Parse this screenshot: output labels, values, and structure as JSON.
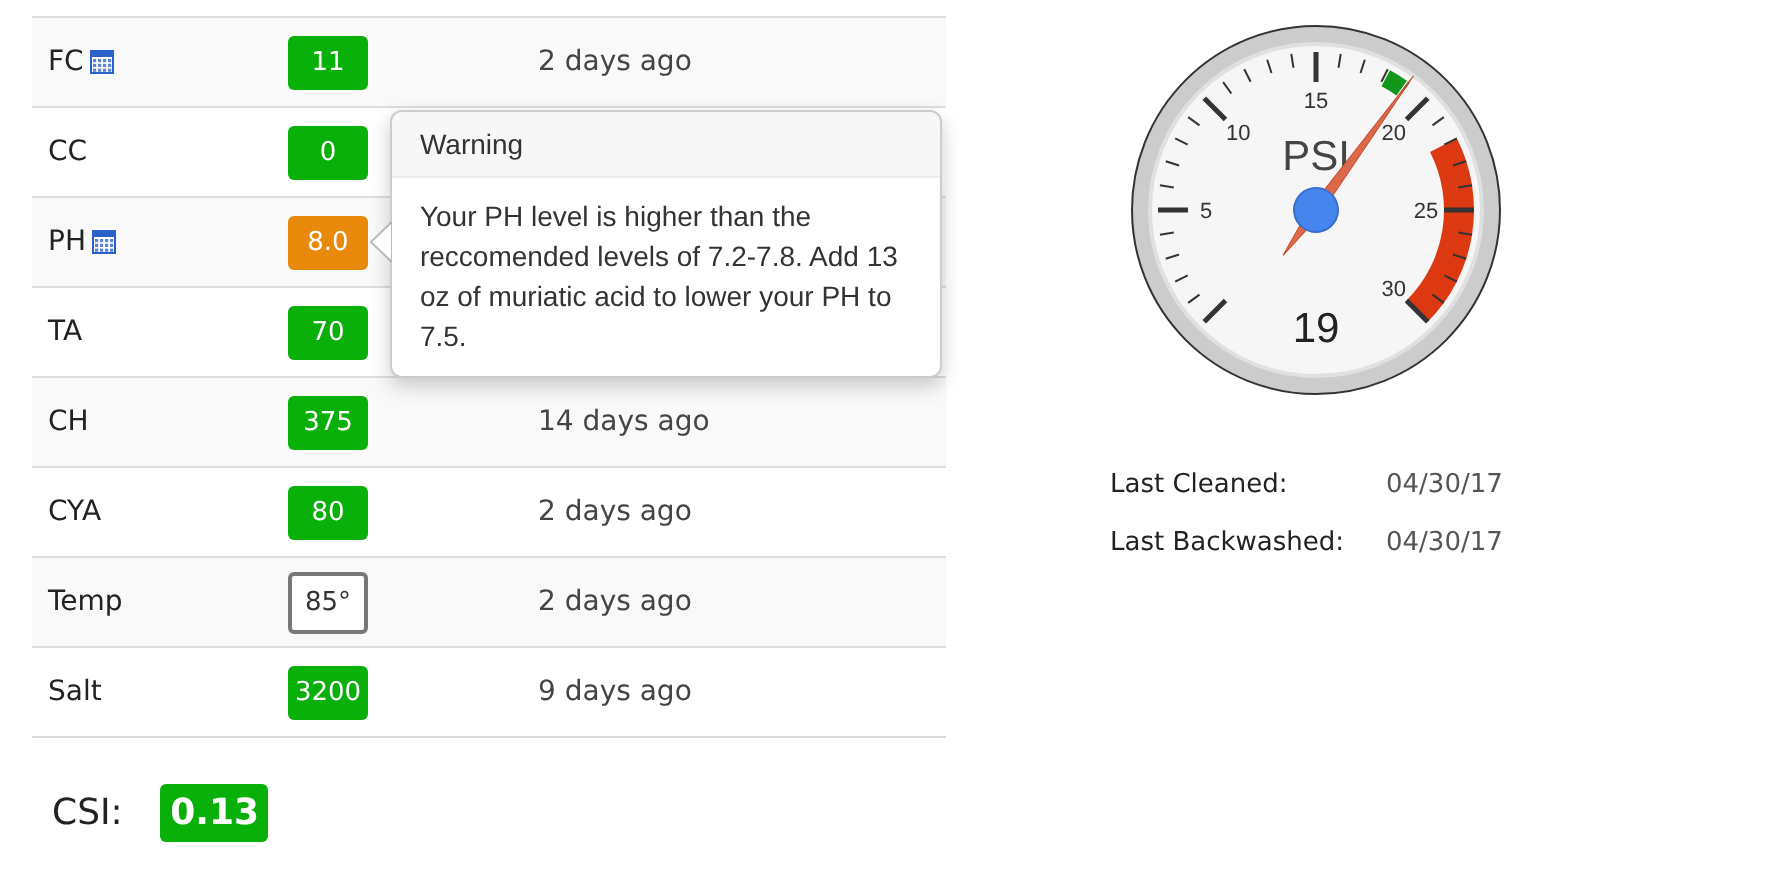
{
  "readings": [
    {
      "name": "FC",
      "calculator": true,
      "value": "11",
      "kind": "filled",
      "color": "#0ab00a",
      "age": "2 days ago"
    },
    {
      "name": "CC",
      "calculator": false,
      "value": "0",
      "kind": "filled",
      "color": "#0ab00a"
    },
    {
      "name": "PH",
      "calculator": true,
      "value": "8.0",
      "kind": "filled",
      "color": "#e8890c"
    },
    {
      "name": "TA",
      "calculator": false,
      "value": "70",
      "kind": "filled",
      "color": "#0ab00a"
    },
    {
      "name": "CH",
      "calculator": false,
      "value": "375",
      "kind": "filled",
      "color": "#0ab00a",
      "age": "14 days ago"
    },
    {
      "name": "CYA",
      "calculator": false,
      "value": "80",
      "kind": "filled",
      "color": "#0ab00a",
      "age": "2 days ago"
    },
    {
      "name": "Temp",
      "calculator": false,
      "value": "85°",
      "kind": "outlined",
      "color": "#777777",
      "age": "2 days ago"
    },
    {
      "name": "Salt",
      "calculator": false,
      "value": "3200",
      "kind": "filled",
      "color": "#0ab00a",
      "age": "9 days ago"
    }
  ],
  "popover": {
    "title": "Warning",
    "text": "Your PH level is higher than the reccomended levels of 7.2-7.8. Add 13 oz of muriatic acid to lower your PH to 7.5."
  },
  "csi": {
    "label": "CSI:",
    "value": "0.13",
    "color": "#0ab00a"
  },
  "gauge": {
    "unit": "PSI",
    "value": "19",
    "tick_labels": [
      "5",
      "10",
      "15",
      "20",
      "25",
      "30"
    ]
  },
  "maintenance": [
    {
      "label": "Last Cleaned:",
      "date": "04/30/17"
    },
    {
      "label": "Last Backwashed:",
      "date": "04/30/17"
    }
  ]
}
